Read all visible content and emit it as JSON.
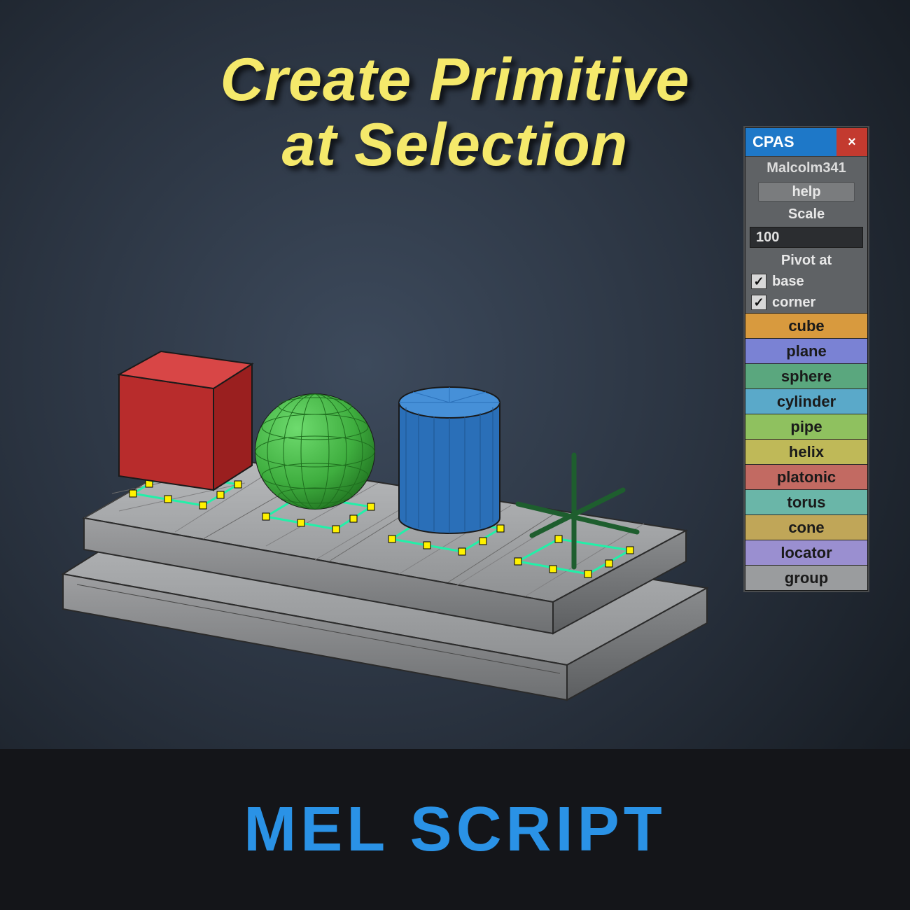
{
  "title_line1": "Create Primitive",
  "title_line2": "at Selection",
  "footer": "MEL SCRIPT",
  "panel": {
    "title": "CPAS",
    "close": "×",
    "author": "Malcolm341",
    "help": "help",
    "scale_label": "Scale",
    "scale_value": "100",
    "pivot_label": "Pivot at",
    "checks": [
      {
        "label": "base",
        "checked": true
      },
      {
        "label": "corner",
        "checked": true
      }
    ],
    "primitives": [
      {
        "label": "cube",
        "color": "#d89a3e"
      },
      {
        "label": "plane",
        "color": "#7a82d4"
      },
      {
        "label": "sphere",
        "color": "#5aa77e"
      },
      {
        "label": "cylinder",
        "color": "#5aa9c9"
      },
      {
        "label": "pipe",
        "color": "#8fc15f"
      },
      {
        "label": "helix",
        "color": "#bfb958"
      },
      {
        "label": "platonic",
        "color": "#c26a62"
      },
      {
        "label": "torus",
        "color": "#6ab6a8"
      },
      {
        "label": "cone",
        "color": "#c0a658"
      },
      {
        "label": "locator",
        "color": "#9a8fd0"
      },
      {
        "label": "group",
        "color": "#9a9c9e"
      }
    ]
  }
}
